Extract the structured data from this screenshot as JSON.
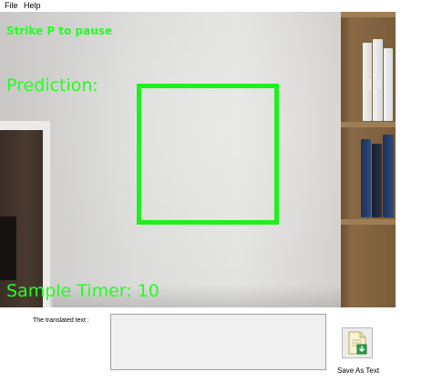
{
  "menu": {
    "items": [
      "File",
      "Help"
    ]
  },
  "video": {
    "pause_hint": "Strike P to pause",
    "prediction_label": "Prediction:",
    "timer_label": "Sample Timer: 10",
    "overlay_color": "#22ff22"
  },
  "form": {
    "translated_label": "The translated text :",
    "translated_text": ""
  },
  "save": {
    "label": "Save As Text",
    "icon": "document-download-icon"
  }
}
